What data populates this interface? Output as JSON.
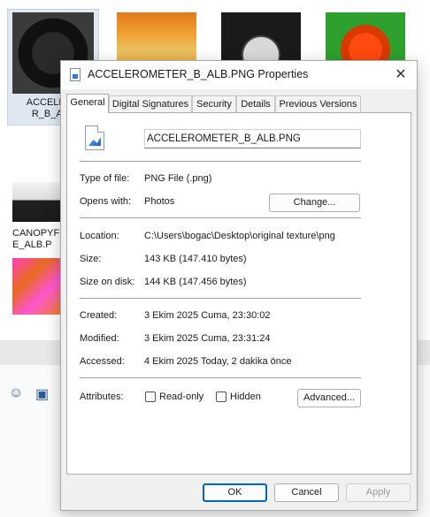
{
  "explorer": {
    "thumbnails": [
      {
        "label_line1": "ACCELERO",
        "label_line2": "R_B_ALB"
      },
      {
        "label_line1": "",
        "label_line2": ""
      },
      {
        "label_line1": "",
        "label_line2": ""
      },
      {
        "label_line1": "",
        "label_line2": ""
      },
      {
        "label_line1": "CANOPYF",
        "label_line2": "E_ALB.P"
      },
      {
        "label_line1": "",
        "label_line2": ""
      }
    ]
  },
  "dialog": {
    "title": "ACCELEROMETER_B_ALB.PNG Properties",
    "close_symbol": "✕",
    "tabs": [
      "General",
      "Digital Signatures",
      "Security",
      "Details",
      "Previous Versions"
    ],
    "active_tab": "General",
    "file_name": "ACCELEROMETER_B_ALB.PNG",
    "fields": {
      "type_label": "Type of file:",
      "type_value": "PNG File (.png)",
      "opens_label": "Opens with:",
      "opens_value": "Photos",
      "change_button": "Change...",
      "location_label": "Location:",
      "location_value": "C:\\Users\\bogac\\Desktop\\original texture\\png",
      "size_label": "Size:",
      "size_value": "143 KB (147.410 bytes)",
      "size_on_disk_label": "Size on disk:",
      "size_on_disk_value": "144 KB (147.456 bytes)",
      "created_label": "Created:",
      "created_value": "3 Ekim 2025 Cuma, 23:30:02",
      "modified_label": "Modified:",
      "modified_value": "3 Ekim 2025 Cuma, 23:31:24",
      "accessed_label": "Accessed:",
      "accessed_value": "4 Ekim 2025 Today, 2 dakika önce",
      "attributes_label": "Attributes:",
      "readonly_label": "Read-only",
      "hidden_label": "Hidden",
      "advanced_button": "Advanced..."
    },
    "footer": {
      "ok": "OK",
      "cancel": "Cancel",
      "apply": "Apply"
    }
  },
  "bottom_toolbar": {
    "emoji_icon": "☺",
    "image_icon": "▣"
  }
}
